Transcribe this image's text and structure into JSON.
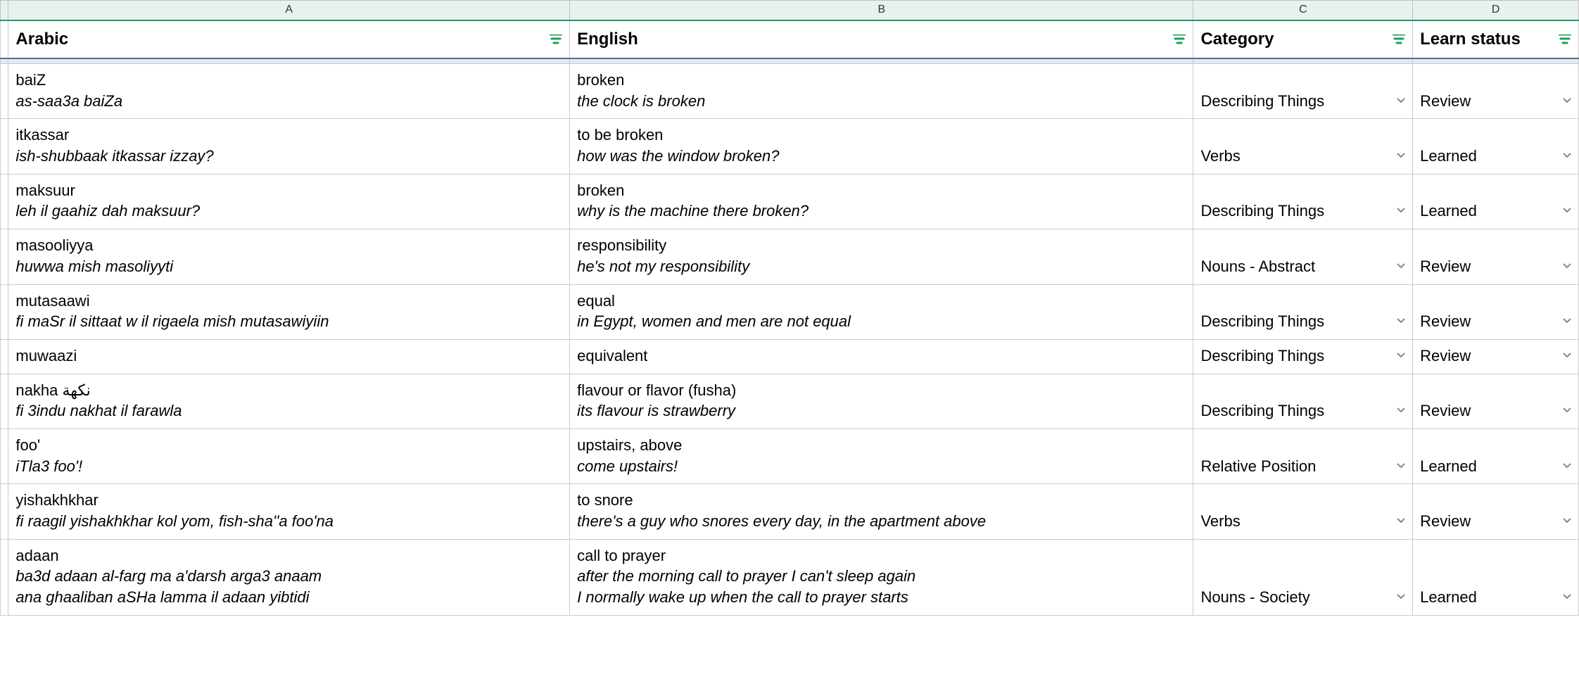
{
  "columns": [
    "A",
    "B",
    "C",
    "D"
  ],
  "headers": {
    "arabic": "Arabic",
    "english": "English",
    "category": "Category",
    "status": "Learn status"
  },
  "rows": [
    {
      "arabic_main": "baiZ",
      "arabic_example": "as-saa3a baiZa",
      "english_main": "broken",
      "english_example": "the clock is broken",
      "category": "Describing Things",
      "status": "Review"
    },
    {
      "arabic_main": "itkassar",
      "arabic_example": "ish-shubbaak itkassar izzay?",
      "english_main": "to be broken",
      "english_example": "how was the window broken?",
      "category": "Verbs",
      "status": "Learned"
    },
    {
      "arabic_main": "maksuur",
      "arabic_example": "leh il gaahiz dah maksuur?",
      "english_main": "broken",
      "english_example": "why is the machine there broken?",
      "category": "Describing Things",
      "status": "Learned"
    },
    {
      "arabic_main": "masooliyya",
      "arabic_example": "huwwa mish masoliyyti",
      "english_main": "responsibility",
      "english_example": "he's not my responsibility",
      "category": "Nouns - Abstract",
      "status": "Review"
    },
    {
      "arabic_main": "mutasaawi",
      "arabic_example": "fi maSr il sittaat w il rigaela mish mutasawiyiin",
      "english_main": "equal",
      "english_example": "in Egypt, women and men are not equal",
      "category": "Describing Things",
      "status": "Review"
    },
    {
      "arabic_main": "muwaazi",
      "arabic_example": "",
      "english_main": "equivalent",
      "english_example": "",
      "category": "Describing Things",
      "status": "Review"
    },
    {
      "arabic_main": "nakha نكهة",
      "arabic_example": "fi 3indu nakhat il farawla",
      "english_main": "flavour or flavor (fusha)",
      "english_example": "its flavour is strawberry",
      "category": "Describing Things",
      "status": "Review"
    },
    {
      "arabic_main": "foo'",
      "arabic_example": "iTla3 foo'!",
      "english_main": "upstairs, above",
      "english_example": "come upstairs!",
      "category": "Relative Position",
      "status": "Learned"
    },
    {
      "arabic_main": "yishakhkhar",
      "arabic_example": "fi raagil yishakhkhar kol yom, fish-sha''a foo'na",
      "english_main": "to snore",
      "english_example": "there's a guy who snores every day, in the apartment above",
      "category": "Verbs",
      "status": "Review"
    },
    {
      "arabic_main": "adaan",
      "arabic_example": "ba3d adaan al-farg ma a'darsh arga3 anaam",
      "arabic_example2": "ana ghaaliban aSHa lamma il adaan yibtidi",
      "english_main": "call to prayer",
      "english_example": "after the morning call to prayer I can't sleep again",
      "english_example2": "I normally wake up when the call to prayer starts",
      "category": "Nouns - Society",
      "status": "Learned"
    }
  ]
}
